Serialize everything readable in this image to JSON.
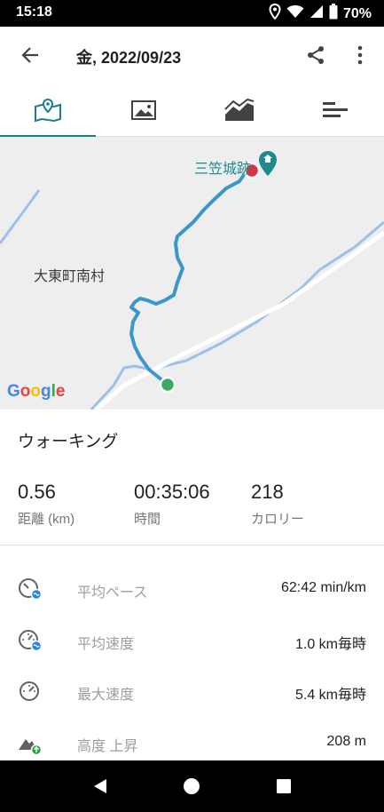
{
  "status_bar": {
    "time": "15:18",
    "battery": "70%",
    "icons": [
      "location-icon",
      "wifi-icon",
      "cellular-signal-icon",
      "battery-icon"
    ]
  },
  "app_bar": {
    "title": "金, 2022/09/23",
    "icons": [
      "back-arrow-icon",
      "share-icon",
      "more-vert-icon"
    ]
  },
  "tabs": [
    {
      "icon": "map-icon",
      "active": true
    },
    {
      "icon": "photo-icon",
      "active": false
    },
    {
      "icon": "chart-icon",
      "active": false
    },
    {
      "icon": "splits-icon",
      "active": false
    }
  ],
  "map": {
    "place_label": "大東町南村",
    "poi_label": "三笠城跡",
    "attribution": "Google"
  },
  "activity": {
    "type": "ウォーキング",
    "stats": [
      {
        "value": "0.56",
        "label": "距離 (km)"
      },
      {
        "value": "00:35:06",
        "label": "時間"
      },
      {
        "value": "218",
        "label": "カロリー"
      }
    ],
    "metrics": [
      {
        "icon": "pace-icon",
        "label": "平均ペース",
        "value": "62:42 min/km"
      },
      {
        "icon": "speedometer-icon",
        "label": "平均速度",
        "value": "1.0 km毎時"
      },
      {
        "icon": "speedometer-icon",
        "label": "最大速度",
        "value": "5.4 km毎時"
      },
      {
        "icon": "elevation-gain-icon",
        "label": "高度 上昇",
        "value": "208 m"
      }
    ]
  },
  "colors": {
    "accent": "#1a7f8a",
    "route": "#3b97c9",
    "start_marker": "#3bab62",
    "end_marker": "#d93245",
    "poi": "#1e8a8f"
  }
}
